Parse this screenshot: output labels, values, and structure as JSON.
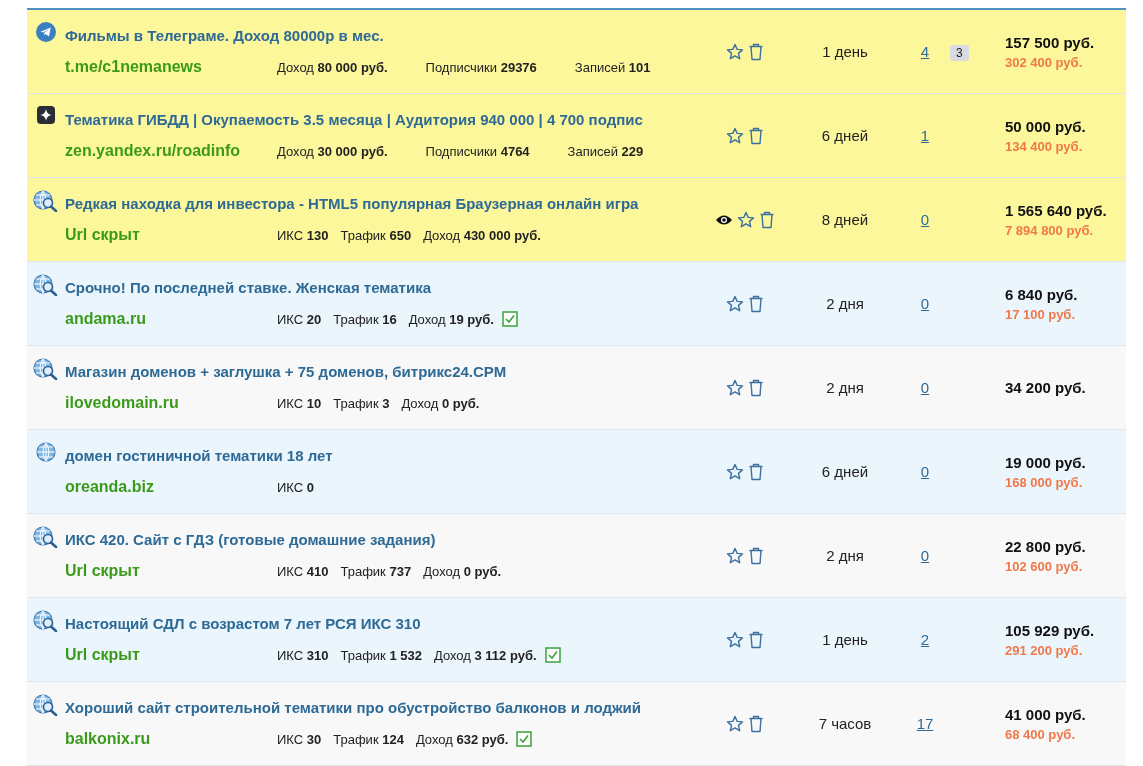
{
  "listings": [
    {
      "kind": "telegram",
      "highlighted": true,
      "title": "Фильмы в Телеграме. Доход 80000р в мес.",
      "url": "t.me/c1nemanews",
      "stats": [
        {
          "label": "Доход",
          "value": "80 000 руб."
        },
        {
          "label": "Подписчики",
          "value": "29376"
        },
        {
          "label": "Записей",
          "value": "101"
        }
      ],
      "verified": false,
      "watched": false,
      "age": "1 день",
      "bids": "4",
      "comments": "3",
      "price": "157 500 руб.",
      "blitz": "302 400 руб."
    },
    {
      "kind": "zen",
      "highlighted": true,
      "title": "Тематика ГИБДД | Окупаемость 3.5 месяца | Аудитория 940 000 | 4 700 подпис",
      "url": "zen.yandex.ru/roadinfo",
      "stats": [
        {
          "label": "Доход",
          "value": "30 000 руб."
        },
        {
          "label": "Подписчики",
          "value": "4764"
        },
        {
          "label": "Записей",
          "value": "229"
        }
      ],
      "verified": false,
      "watched": false,
      "age": "6 дней",
      "bids": "1",
      "price": "50 000 руб.",
      "blitz": "134 400 руб."
    },
    {
      "kind": "site",
      "highlighted": true,
      "title": "Редкая находка для инвестора - HTML5 популярная Браузерная онлайн игра",
      "url": "Url скрыт",
      "stats": [
        {
          "label": "ИКС",
          "value": "130"
        },
        {
          "label": "Трафик",
          "value": "650"
        },
        {
          "label": "Доход",
          "value": "430 000 руб."
        }
      ],
      "verified": false,
      "watched": true,
      "age": "8 дней",
      "bids": "0",
      "price": "1 565 640 руб.",
      "blitz": "7 894 800 руб."
    },
    {
      "kind": "site",
      "highlighted": false,
      "title": "Срочно! По последней ставке. Женская тематика",
      "url": "andama.ru",
      "stats": [
        {
          "label": "ИКС",
          "value": "20"
        },
        {
          "label": "Трафик",
          "value": "16"
        },
        {
          "label": "Доход",
          "value": "19 руб."
        }
      ],
      "verified": true,
      "watched": false,
      "age": "2 дня",
      "bids": "0",
      "price": "6 840 руб.",
      "blitz": "17 100 руб."
    },
    {
      "kind": "site",
      "highlighted": false,
      "title": "Магазин доменов + заглушка + 75 доменов, битрикс24.CPM",
      "url": "ilovedomain.ru",
      "stats": [
        {
          "label": "ИКС",
          "value": "10"
        },
        {
          "label": "Трафик",
          "value": "3"
        },
        {
          "label": "Доход",
          "value": "0 руб."
        }
      ],
      "verified": false,
      "watched": false,
      "age": "2 дня",
      "bids": "0",
      "price": "34 200 руб."
    },
    {
      "kind": "domain",
      "highlighted": false,
      "title": "домен гостиничной тематики 18 лет",
      "url": "oreanda.biz",
      "stats": [
        {
          "label": "ИКС",
          "value": "0"
        }
      ],
      "verified": false,
      "watched": false,
      "age": "6 дней",
      "bids": "0",
      "price": "19 000 руб.",
      "blitz": "168 000 руб."
    },
    {
      "kind": "site",
      "highlighted": false,
      "title": "ИКС 420. Сайт с ГДЗ (готовые домашние задания)",
      "url": "Url скрыт",
      "stats": [
        {
          "label": "ИКС",
          "value": "410"
        },
        {
          "label": "Трафик",
          "value": "737"
        },
        {
          "label": "Доход",
          "value": "0 руб."
        }
      ],
      "verified": false,
      "watched": false,
      "age": "2 дня",
      "bids": "0",
      "price": "22 800 руб.",
      "blitz": "102 600 руб."
    },
    {
      "kind": "site",
      "highlighted": false,
      "title": "Настоящий СДЛ с возрастом 7 лет РСЯ ИКС 310",
      "url": "Url скрыт",
      "stats": [
        {
          "label": "ИКС",
          "value": "310"
        },
        {
          "label": "Трафик",
          "value": "1 532"
        },
        {
          "label": "Доход",
          "value": "3 112 руб."
        }
      ],
      "verified": true,
      "watched": false,
      "age": "1 день",
      "bids": "2",
      "price": "105 929 руб.",
      "blitz": "291 200 руб."
    },
    {
      "kind": "site",
      "highlighted": false,
      "title": "Хороший сайт строительной тематики про обустройство балконов и лоджий",
      "url": "balkonix.ru",
      "stats": [
        {
          "label": "ИКС",
          "value": "30"
        },
        {
          "label": "Трафик",
          "value": "124"
        },
        {
          "label": "Доход",
          "value": "632 руб."
        }
      ],
      "verified": true,
      "watched": false,
      "age": "7 часов",
      "bids": "17",
      "price": "41 000 руб.",
      "blitz": "68 400 руб."
    }
  ]
}
